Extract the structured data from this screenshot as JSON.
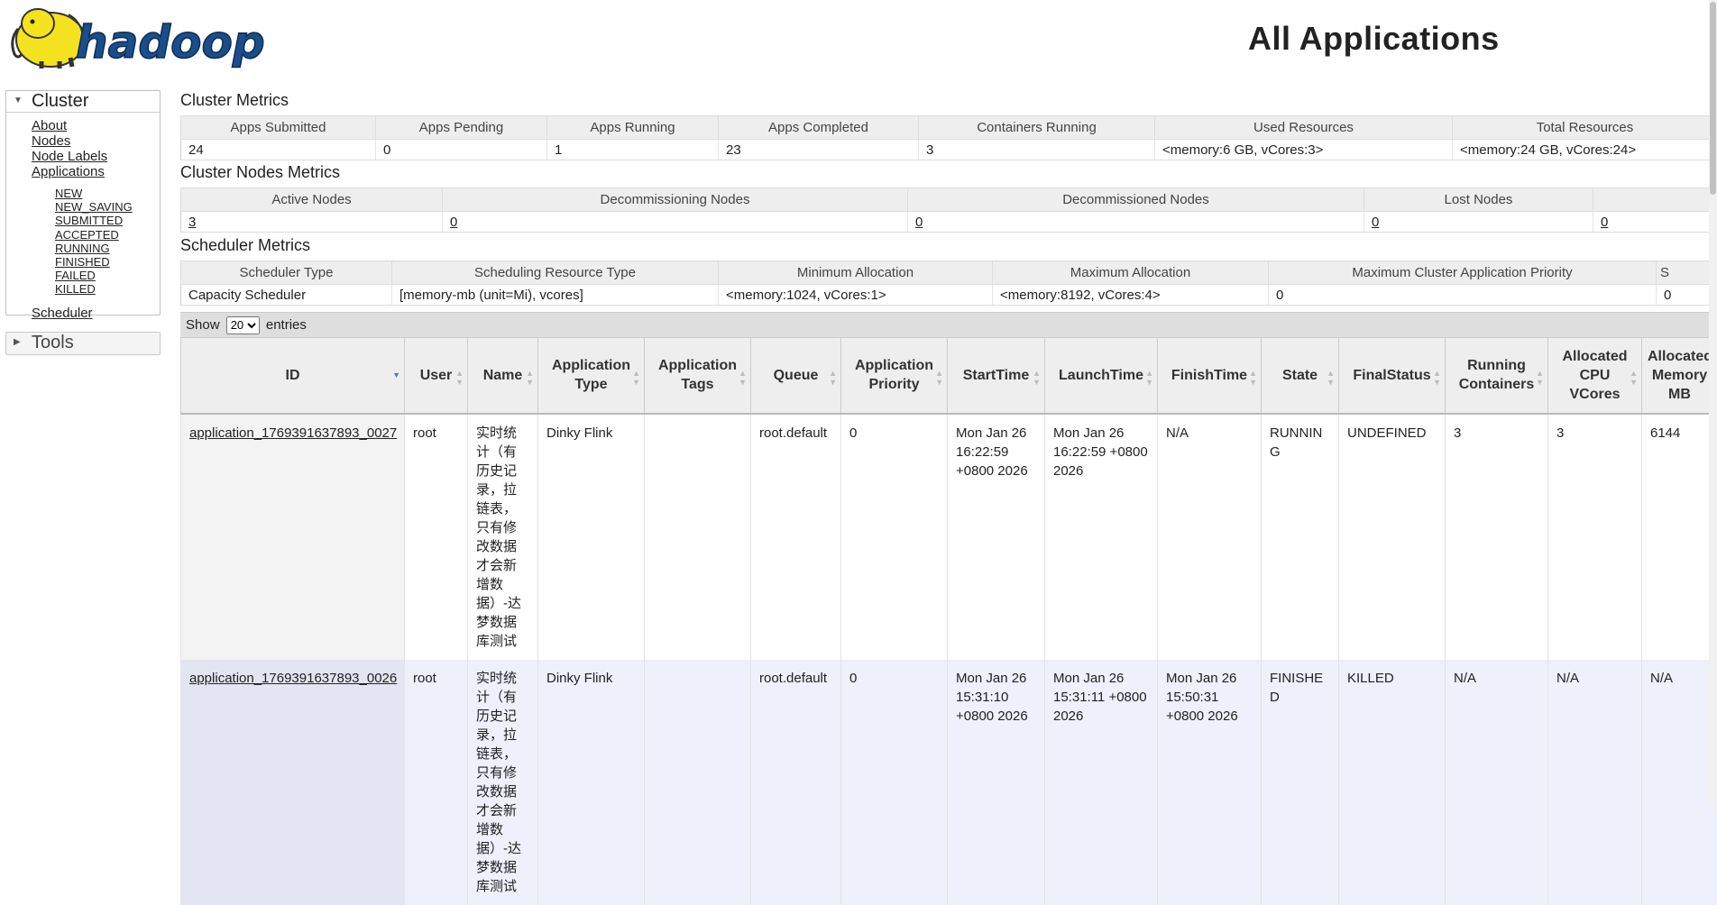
{
  "header": {
    "logo_text": "hadoop",
    "page_title": "All Applications"
  },
  "sidebar": {
    "cluster": {
      "title": "Cluster",
      "items": [
        "About",
        "Nodes",
        "Node Labels",
        "Applications"
      ],
      "app_states": [
        "NEW",
        "NEW_SAVING",
        "SUBMITTED",
        "ACCEPTED",
        "RUNNING",
        "FINISHED",
        "FAILED",
        "KILLED"
      ],
      "scheduler": "Scheduler"
    },
    "tools": {
      "title": "Tools"
    }
  },
  "cluster_metrics": {
    "title": "Cluster Metrics",
    "headers": [
      "Apps Submitted",
      "Apps Pending",
      "Apps Running",
      "Apps Completed",
      "Containers Running",
      "Used Resources",
      "Total Resources"
    ],
    "values": [
      "24",
      "0",
      "1",
      "23",
      "3",
      "<memory:6 GB, vCores:3>",
      "<memory:24 GB, vCores:24>"
    ]
  },
  "nodes_metrics": {
    "title": "Cluster Nodes Metrics",
    "headers": [
      "Active Nodes",
      "Decommissioning Nodes",
      "Decommissioned Nodes",
      "Lost Nodes",
      ""
    ],
    "values": [
      "3",
      "0",
      "0",
      "0",
      "0"
    ]
  },
  "scheduler_metrics": {
    "title": "Scheduler Metrics",
    "headers": [
      "Scheduler Type",
      "Scheduling Resource Type",
      "Minimum Allocation",
      "Maximum Allocation",
      "Maximum Cluster Application Priority",
      "S"
    ],
    "values": [
      "Capacity Scheduler",
      "[memory-mb (unit=Mi), vcores]",
      "<memory:1024, vCores:1>",
      "<memory:8192, vCores:4>",
      "0",
      "0"
    ]
  },
  "apps": {
    "show_label": "Show",
    "entries_label": "entries",
    "page_size": "20",
    "page_size_options": [
      "20"
    ],
    "headers": [
      "ID",
      "User",
      "Name",
      "Application Type",
      "Application Tags",
      "Queue",
      "Application Priority",
      "StartTime",
      "LaunchTime",
      "FinishTime",
      "State",
      "FinalStatus",
      "Running Containers",
      "Allocated CPU VCores",
      "Allocated Memory MB"
    ],
    "rows": [
      [
        "application_1769391637893_0027",
        "root",
        "实时统计（有历史记录，拉链表，只有修改数据才会新增数据）-达梦数据库测试",
        "Dinky Flink",
        "",
        "root.default",
        "0",
        "Mon Jan 26 16:22:59 +0800 2026",
        "Mon Jan 26 16:22:59 +0800 2026",
        "N/A",
        "RUNNING",
        "UNDEFINED",
        "3",
        "3",
        "6144"
      ],
      [
        "application_1769391637893_0026",
        "root",
        "实时统计（有历史记录，拉链表，只有修改数据才会新增数据）-达梦数据库测试",
        "Dinky Flink",
        "",
        "root.default",
        "0",
        "Mon Jan 26 15:31:10 +0800 2026",
        "Mon Jan 26 15:31:11 +0800 2026",
        "Mon Jan 26 15:50:31 +0800 2026",
        "FINISHED",
        "KILLED",
        "N/A",
        "N/A",
        "N/A"
      ]
    ]
  },
  "colors": {
    "header_bg": "#eeeeee",
    "odd_row_bg": "#eef0fb",
    "logo_yellow": "#f5e21f",
    "logo_blue": "#1a4e8a"
  }
}
